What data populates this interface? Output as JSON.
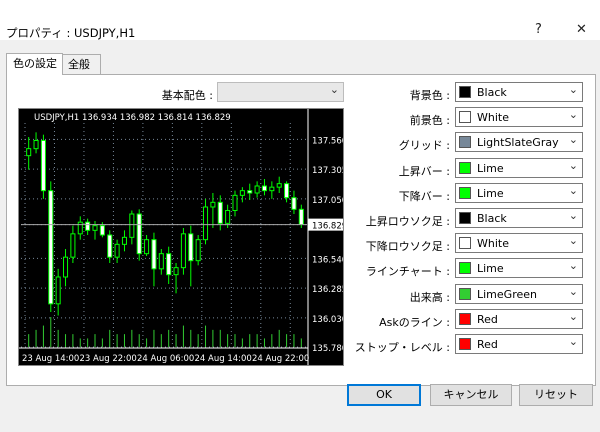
{
  "window": {
    "title": "プロパティ : USDJPY,H1",
    "help": "?",
    "close": "✕"
  },
  "tabs": [
    {
      "label": "色の設定"
    },
    {
      "label": "全般"
    }
  ],
  "scheme": {
    "label": "基本配色 :",
    "value": ""
  },
  "chart": {
    "header": "USDJPY,H1  136.934 136.982 136.814 136.829",
    "y_ticks": [
      "137.560",
      "137.305",
      "137.050",
      "136.829",
      "136.540",
      "136.285",
      "136.030",
      "135.780"
    ],
    "x_ticks": [
      "23 Aug 14:00",
      "23 Aug 22:00",
      "24 Aug 06:00",
      "24 Aug 14:00",
      "24 Aug 22:00"
    ],
    "colors": {
      "background": "#000000",
      "foreground": "#ffffff",
      "grid": "#778899",
      "bull": "#00ff00",
      "bear": "#00ff00",
      "bull_body": "#000000",
      "bear_body": "#ffffff",
      "volume": "#32cd32"
    }
  },
  "chart_data": {
    "type": "candlestick",
    "title": "USDJPY,H1",
    "ylim": [
      135.78,
      137.7
    ],
    "y_tick_values": [
      137.56,
      137.305,
      137.05,
      136.829,
      136.54,
      136.285,
      136.03,
      135.78
    ],
    "current_price": 136.829,
    "candles": [
      [
        137.42,
        137.58,
        137.3,
        137.48
      ],
      [
        137.48,
        137.62,
        137.44,
        137.55
      ],
      [
        137.55,
        137.6,
        137.05,
        137.12
      ],
      [
        137.12,
        137.2,
        136.08,
        136.15
      ],
      [
        136.15,
        136.45,
        136.05,
        136.38
      ],
      [
        136.38,
        136.62,
        136.3,
        136.55
      ],
      [
        136.55,
        136.82,
        136.5,
        136.75
      ],
      [
        136.75,
        136.9,
        136.7,
        136.85
      ],
      [
        136.85,
        136.88,
        136.74,
        136.78
      ],
      [
        136.78,
        136.86,
        136.7,
        136.82
      ],
      [
        136.82,
        136.85,
        136.72,
        136.74
      ],
      [
        136.74,
        136.78,
        136.5,
        136.55
      ],
      [
        136.55,
        136.7,
        136.5,
        136.66
      ],
      [
        136.66,
        136.78,
        136.6,
        136.72
      ],
      [
        136.72,
        136.95,
        136.66,
        136.92
      ],
      [
        136.92,
        136.96,
        136.52,
        136.58
      ],
      [
        136.58,
        136.74,
        136.56,
        136.7
      ],
      [
        136.7,
        136.76,
        136.3,
        136.45
      ],
      [
        136.45,
        136.62,
        136.4,
        136.58
      ],
      [
        136.58,
        136.64,
        136.32,
        136.4
      ],
      [
        136.4,
        136.5,
        136.24,
        136.46
      ],
      [
        136.46,
        136.8,
        136.4,
        136.75
      ],
      [
        136.75,
        136.82,
        136.3,
        136.52
      ],
      [
        136.52,
        136.74,
        136.48,
        136.7
      ],
      [
        136.7,
        137.05,
        136.66,
        136.98
      ],
      [
        136.98,
        137.1,
        136.8,
        137.02
      ],
      [
        137.02,
        137.08,
        136.78,
        136.84
      ],
      [
        136.84,
        137.0,
        136.8,
        136.95
      ],
      [
        136.95,
        137.12,
        136.9,
        137.08
      ],
      [
        137.08,
        137.15,
        137.02,
        137.12
      ],
      [
        137.12,
        137.18,
        137.04,
        137.1
      ],
      [
        137.1,
        137.2,
        137.06,
        137.16
      ],
      [
        137.16,
        137.22,
        137.08,
        137.12
      ],
      [
        137.12,
        137.2,
        137.05,
        137.15
      ],
      [
        137.15,
        137.24,
        137.1,
        137.18
      ],
      [
        137.18,
        137.2,
        137.02,
        137.06
      ],
      [
        137.06,
        137.12,
        136.92,
        136.96
      ],
      [
        136.96,
        137.0,
        136.8,
        136.83
      ]
    ],
    "volumes": [
      3,
      4,
      5,
      7,
      4,
      3,
      3,
      2,
      2,
      3,
      2,
      4,
      3,
      3,
      4,
      3,
      2,
      4,
      3,
      4,
      3,
      5,
      4,
      3,
      5,
      4,
      4,
      3,
      3,
      2,
      3,
      3,
      2,
      3,
      4,
      3,
      3,
      2
    ]
  },
  "settings": [
    {
      "key": "bg",
      "label": "背景色 :",
      "value": "Black",
      "color": "#000000"
    },
    {
      "key": "fg",
      "label": "前景色 :",
      "value": "White",
      "color": "#ffffff"
    },
    {
      "key": "grid",
      "label": "グリッド :",
      "value": "LightSlateGray",
      "color": "#778899"
    },
    {
      "key": "barup",
      "label": "上昇バー :",
      "value": "Lime",
      "color": "#00ff00"
    },
    {
      "key": "bardown",
      "label": "下降バー :",
      "value": "Lime",
      "color": "#00ff00"
    },
    {
      "key": "bullcandle",
      "label": "上昇ロウソク足 :",
      "value": "Black",
      "color": "#000000"
    },
    {
      "key": "bearcandle",
      "label": "下降ロウソク足 :",
      "value": "White",
      "color": "#ffffff"
    },
    {
      "key": "linechart",
      "label": "ラインチャート :",
      "value": "Lime",
      "color": "#00ff00"
    },
    {
      "key": "volume",
      "label": "出来高 :",
      "value": "LimeGreen",
      "color": "#32cd32"
    },
    {
      "key": "askline",
      "label": "Askのライン :",
      "value": "Red",
      "color": "#ff0000"
    },
    {
      "key": "stoplevel",
      "label": "ストップ・レベル :",
      "value": "Red",
      "color": "#ff0000"
    }
  ],
  "buttons": {
    "ok": "OK",
    "cancel": "キャンセル",
    "reset": "リセット"
  }
}
